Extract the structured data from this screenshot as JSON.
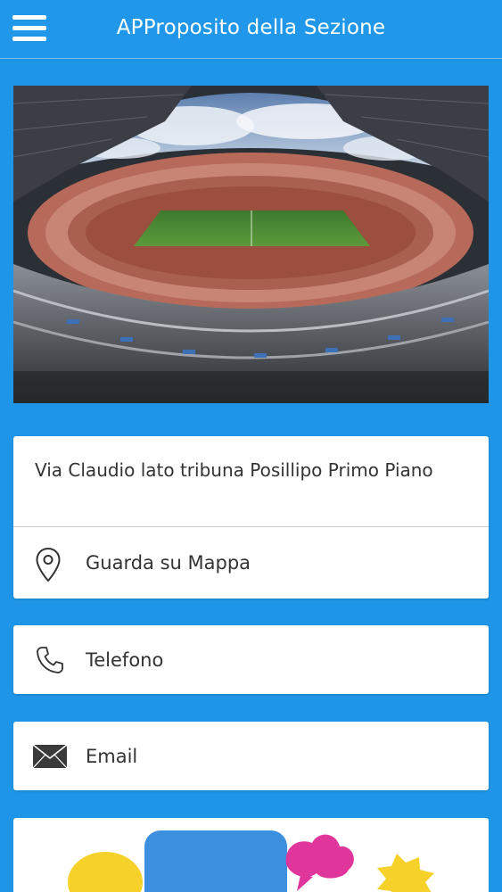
{
  "header": {
    "title": "APProposito della Sezione",
    "menu_icon": "hamburger-menu-icon"
  },
  "hero": {
    "image_subject": "football stadium interior"
  },
  "location_card": {
    "address": "Via Claudio lato tribuna Posillipo Primo Piano",
    "map_label": "Guarda su Mappa",
    "map_icon": "map-pin-icon"
  },
  "phone_card": {
    "label": "Telefono",
    "icon": "phone-icon"
  },
  "email_card": {
    "label": "Email",
    "icon": "envelope-icon"
  },
  "colors": {
    "background": "#1e95e6",
    "card": "#ffffff",
    "text": "#333333"
  }
}
